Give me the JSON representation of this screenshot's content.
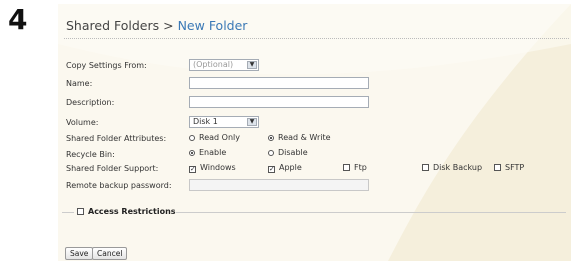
{
  "step_number": "4",
  "breadcrumb": {
    "parent": "Shared Folders",
    "separator": ">",
    "current": "New Folder"
  },
  "form": {
    "copy_settings": {
      "label": "Copy Settings From:",
      "value": "(Optional)"
    },
    "name": {
      "label": "Name:",
      "value": ""
    },
    "description": {
      "label": "Description:",
      "value": ""
    },
    "volume": {
      "label": "Volume:",
      "value": "Disk 1"
    },
    "attributes": {
      "label": "Shared Folder Attributes:",
      "options": [
        {
          "label": "Read Only",
          "checked": false
        },
        {
          "label": "Read & Write",
          "checked": true
        }
      ]
    },
    "recycle_bin": {
      "label": "Recycle Bin:",
      "options": [
        {
          "label": "Enable",
          "checked": true
        },
        {
          "label": "Disable",
          "checked": false
        }
      ]
    },
    "support": {
      "label": "Shared Folder Support:",
      "options": [
        {
          "label": "Windows",
          "checked": true
        },
        {
          "label": "Apple",
          "checked": true
        },
        {
          "label": "Ftp",
          "checked": false
        },
        {
          "label": "Disk Backup",
          "checked": false
        },
        {
          "label": "SFTP",
          "checked": false
        }
      ]
    },
    "remote_backup_password": {
      "label": "Remote backup password:",
      "value": ""
    }
  },
  "access_restrictions": {
    "label": "Access Restrictions",
    "checked": false
  },
  "buttons": {
    "save": "Save",
    "cancel": "Cancel"
  }
}
